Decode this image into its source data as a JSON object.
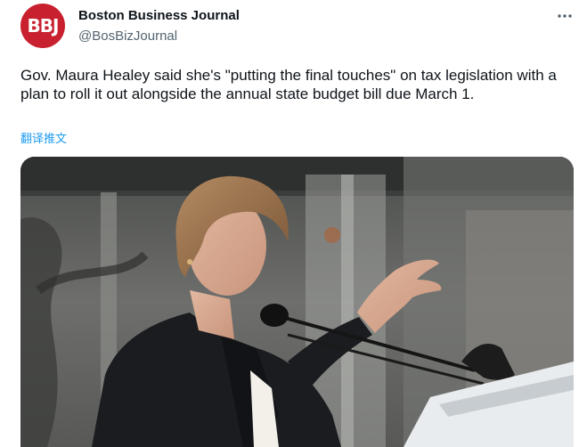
{
  "author": {
    "avatar_text": "BBJ",
    "name": "Boston Business Journal",
    "handle": "@BosBizJournal"
  },
  "tweet": {
    "text": "Gov. Maura Healey said she's \"putting the final touches\" on tax legislation with a plan to roll it out alongside the annual state budget bill due March 1.",
    "translate_label": "翻译推文"
  },
  "icons": {
    "more": "more-horizontal-icon"
  },
  "colors": {
    "brand": "#c8202f",
    "link": "#1d9bf0",
    "text": "#0f1419",
    "secondary": "#536471"
  }
}
